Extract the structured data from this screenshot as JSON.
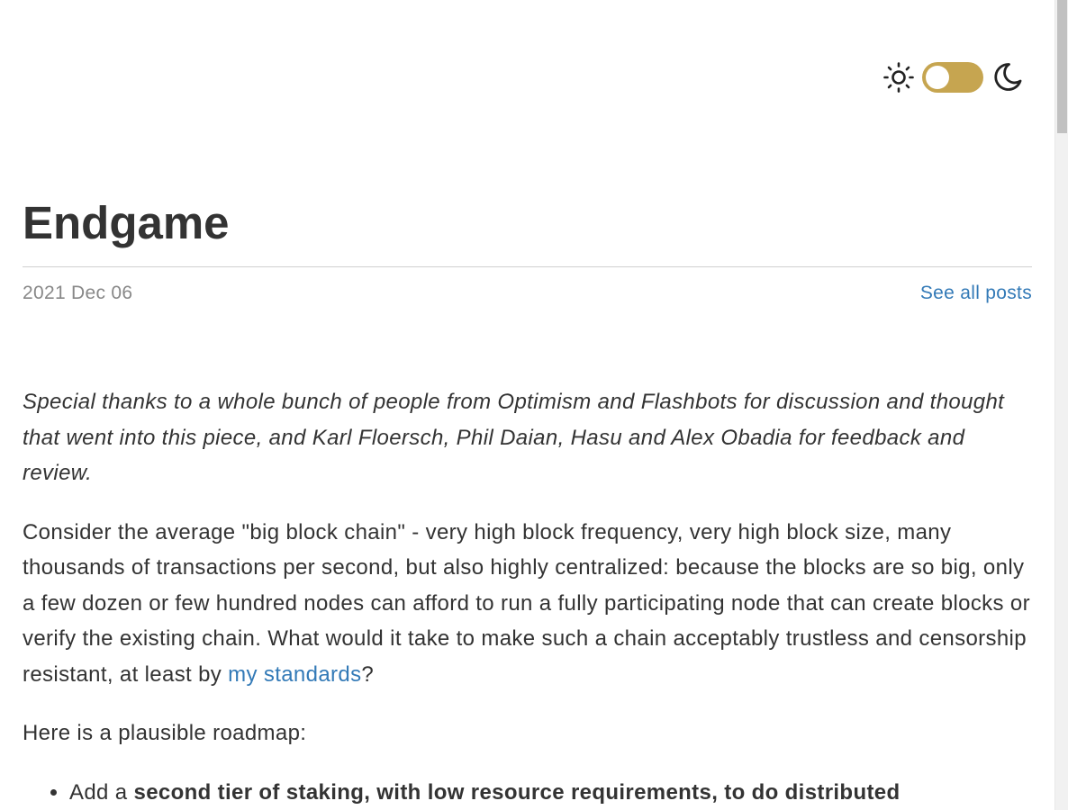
{
  "theme_toggle": {
    "light_icon": "sun-icon",
    "dark_icon": "moon-icon",
    "accent_color": "#c6a550"
  },
  "post": {
    "title": "Endgame",
    "date": "2021 Dec 06",
    "see_all_label": "See all posts",
    "thanks": "Special thanks to a whole bunch of people from Optimism and Flashbots for discussion and thought that went into this piece, and Karl Floersch, Phil Daian, Hasu and Alex Obadia for feedback and review.",
    "para1_before": "Consider the average \"big block chain\" - very high block frequency, very high block size, many thousands of transactions per second, but also highly centralized: because the blocks are so big, only a few dozen or few hundred nodes can afford to run a fully participating node that can create blocks or verify the existing chain. What would it take to make such a chain acceptably trustless and censorship resistant, at least by ",
    "para1_link": "my standards",
    "para1_after": "?",
    "para2": "Here is a plausible roadmap:",
    "list_item1_prefix": "Add a ",
    "list_item1_bold": "second tier of staking, with low resource requirements, to do distributed"
  },
  "link_color": "#337ab7"
}
